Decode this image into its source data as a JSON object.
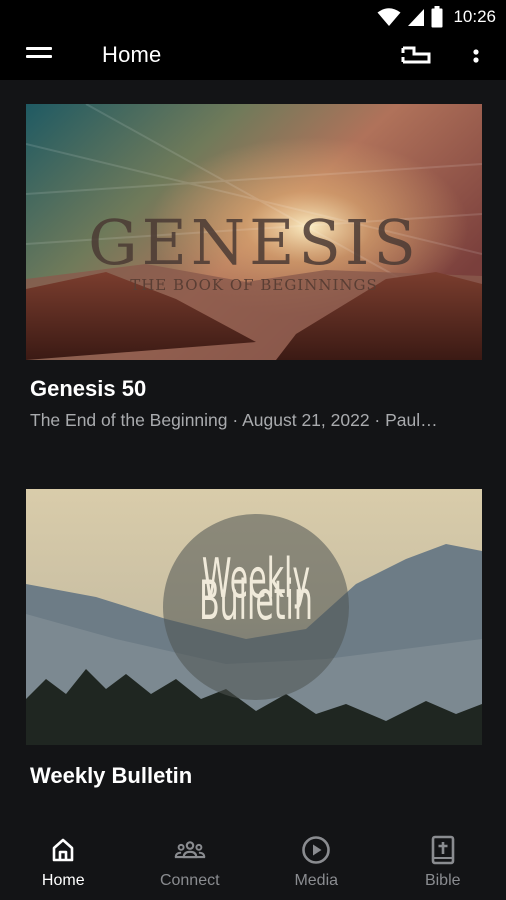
{
  "status_bar": {
    "time": "10:26"
  },
  "app_bar": {
    "title": "Home"
  },
  "cards": [
    {
      "image_title": "GENESIS",
      "image_subtitle": "THE BOOK OF BEGINNINGS",
      "title": "Genesis 50",
      "subtitle": "The End of the Beginning · August 21, 2022 · Paul…"
    },
    {
      "image_line1": "Weekly",
      "image_line2": "Bulletin",
      "title": "Weekly Bulletin"
    }
  ],
  "bottom_nav": {
    "items": [
      {
        "label": "Home",
        "icon": "home-icon",
        "active": true
      },
      {
        "label": "Connect",
        "icon": "group-icon",
        "active": false
      },
      {
        "label": "Media",
        "icon": "play-circle-icon",
        "active": false
      },
      {
        "label": "Bible",
        "icon": "bible-icon",
        "active": false
      }
    ]
  },
  "colors": {
    "background": "#131416",
    "bar": "#000000",
    "muted_text": "#a9abae",
    "inactive_nav": "#8a8c90"
  }
}
